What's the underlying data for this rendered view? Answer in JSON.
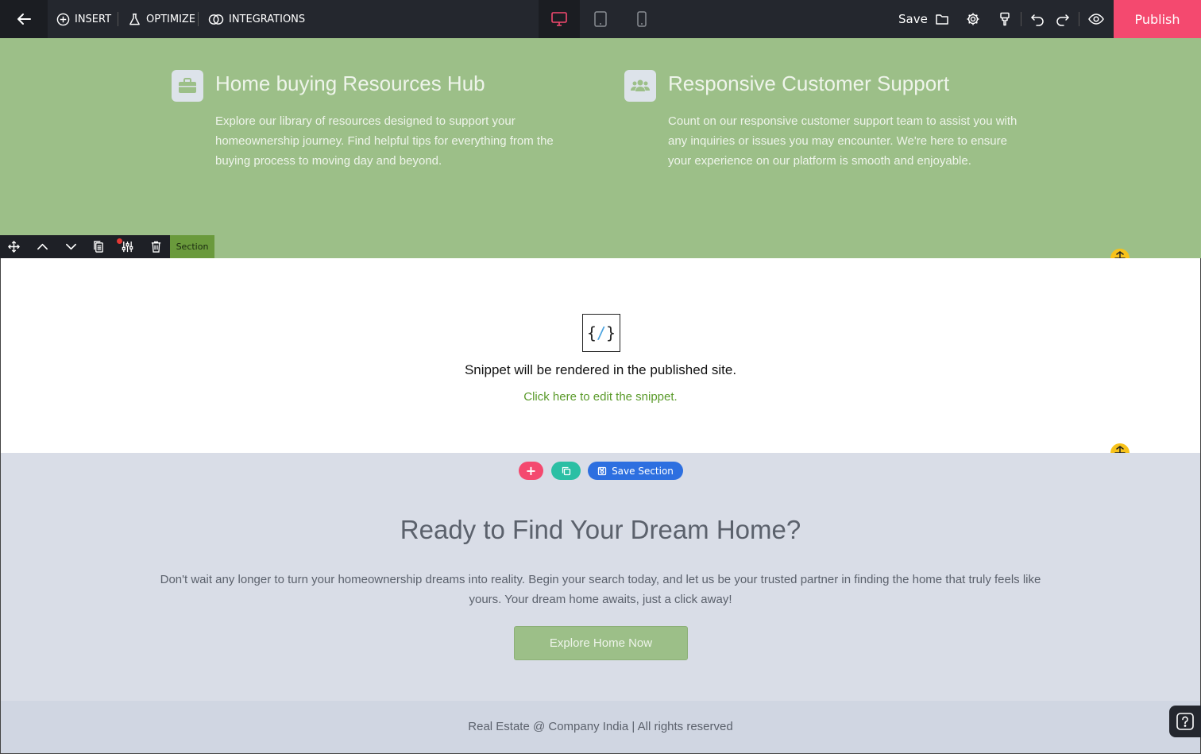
{
  "toolbar": {
    "insert_label": "INSERT",
    "optimize_label": "OPTIMIZE",
    "integrations_label": "INTEGRATIONS",
    "save_label": "Save",
    "publish_label": "Publish",
    "devices": [
      "desktop-icon",
      "tablet-icon",
      "mobile-icon"
    ],
    "active_device": "desktop",
    "tools": [
      "folder-icon",
      "gear-icon",
      "paint-brush-icon",
      "undo-icon",
      "redo-icon",
      "eye-icon"
    ]
  },
  "features": [
    {
      "icon": "briefcase-icon",
      "title": "Home buying Resources Hub",
      "description": "Explore our library of resources designed to support your homeownership journey. Find helpful tips for everything from the buying process to moving day and beyond."
    },
    {
      "icon": "users-icon",
      "title": "Responsive Customer Support",
      "description": "Count on our responsive customer support team to assist you with any inquiries or issues you may encounter. We're here to ensure your experience on our platform is smooth and enjoyable."
    }
  ],
  "section_toolbar": {
    "tools": [
      "move-icon",
      "chevron-up-icon",
      "chevron-down-icon",
      "duplicate-icon",
      "settings-sliders-icon",
      "trash-icon"
    ],
    "label": "Section"
  },
  "snippet": {
    "icon_text": "{/}",
    "message": "Snippet will be rendered in the published site.",
    "edit_link": "Click here to edit the snippet."
  },
  "section_actions": {
    "add_label": "+",
    "save_section_label": "Save Section"
  },
  "cta": {
    "title": "Ready to Find Your Dream Home?",
    "description": "Don't wait any longer to turn your homeownership dreams into reality. Begin your search today, and let us be your trusted partner in finding the home that truly feels like yours. Your dream home awaits, just a click away!",
    "button_label": "Explore Home Now"
  },
  "footer": {
    "text": "Real Estate @ Company India | All rights reserved"
  },
  "colors": {
    "accent": "#f4496f",
    "feature_bg": "#9cbf88",
    "cta_bg": "#d9dde7",
    "link": "#5a9a2a",
    "handle": "#f7c21a"
  }
}
